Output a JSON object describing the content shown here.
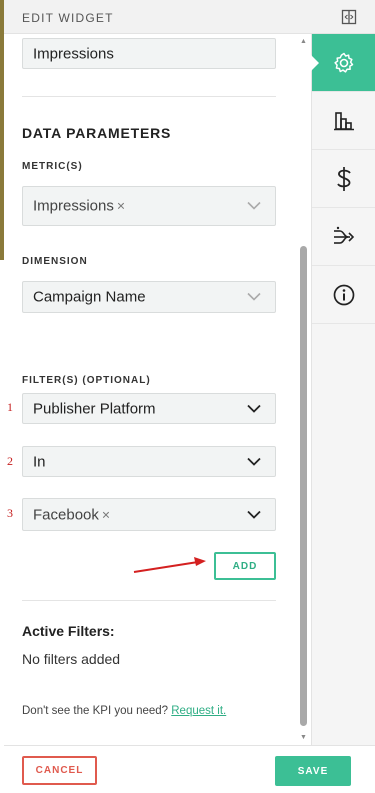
{
  "header": {
    "title": "EDIT WIDGET",
    "collapse_icon": "collapse-panel-icon"
  },
  "form": {
    "widget_title_value": "Impressions",
    "data_parameters_title": "DATA PARAMETERS",
    "metric_label": "METRIC(S)",
    "metric_selected": "Impressions",
    "dimension_label": "DIMENSION",
    "dimension_value": "Campaign Name",
    "filters_label": "FILTER(S) (OPTIONAL)",
    "filters": [
      {
        "number": "1",
        "value": "Publisher Platform"
      },
      {
        "number": "2",
        "value": "In"
      },
      {
        "number": "3",
        "value": "Facebook"
      }
    ],
    "add_label": "ADD",
    "active_filters_title": "Active Filters:",
    "no_filters_text": "No filters added",
    "kpi_note_prefix": "Don't see the KPI you need?",
    "kpi_note_link": "Request it."
  },
  "chip_remove": "×",
  "sidebar": {
    "items": [
      {
        "icon": "gear-icon",
        "active": true
      },
      {
        "icon": "bar-chart-icon",
        "active": false
      },
      {
        "icon": "dollar-icon",
        "active": false
      },
      {
        "icon": "branch-flow-icon",
        "active": false
      },
      {
        "icon": "info-icon",
        "active": false
      }
    ]
  },
  "footer": {
    "cancel_label": "CANCEL",
    "save_label": "SAVE"
  },
  "colors": {
    "accent": "#3cbf95",
    "danger": "#e05a4e",
    "annotation": "#c62020"
  }
}
